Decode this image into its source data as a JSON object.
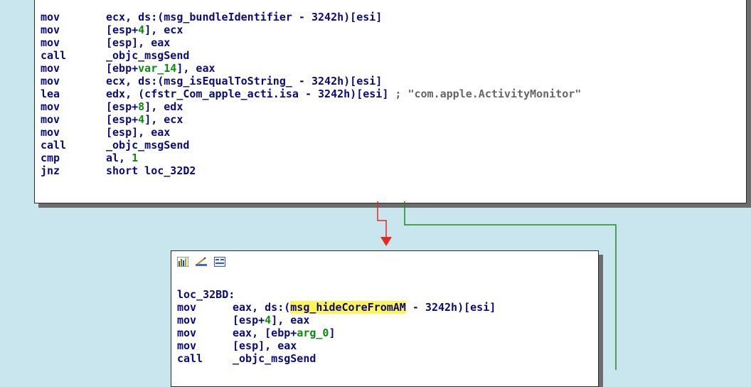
{
  "top_block": {
    "lines": [
      {
        "mnemonic": "mov",
        "p1": "ecx, ds:(msg_bundleIdentifier - 3242h)[esi]"
      },
      {
        "mnemonic": "mov",
        "p1": "[esp+",
        "n1": "4",
        "p2": "], ecx"
      },
      {
        "mnemonic": "mov",
        "p1": "[esp], eax"
      },
      {
        "mnemonic": "call",
        "p1": "_objc_msgSend"
      },
      {
        "mnemonic": "mov",
        "p1": "[ebp+",
        "v1": "var_14",
        "p2": "], eax"
      },
      {
        "mnemonic": "mov",
        "p1": "ecx, ds:(msg_isEqualToString_ - 3242h)[esi]"
      },
      {
        "mnemonic": "lea",
        "p1": "edx, (cfstr_Com_apple_acti.isa - 3242h)[esi]",
        "comment": " ; \"com.apple.ActivityMonitor\""
      },
      {
        "mnemonic": "mov",
        "p1": "[esp+",
        "n1": "8",
        "p2": "], edx"
      },
      {
        "mnemonic": "mov",
        "p1": "[esp+",
        "n1": "4",
        "p2": "], ecx"
      },
      {
        "mnemonic": "mov",
        "p1": "[esp], eax"
      },
      {
        "mnemonic": "call",
        "p1": "_objc_msgSend"
      },
      {
        "mnemonic": "cmp",
        "p1": "al, ",
        "n1": "1"
      },
      {
        "mnemonic": "jnz",
        "p1": "short loc_32D2"
      }
    ]
  },
  "bottom_block": {
    "label": "loc_32BD:",
    "lines": [
      {
        "mnemonic": "mov",
        "p1": "eax, ds:(",
        "h1": "msg_hideCoreFromAM",
        "p2": " - 3242h)[esi]"
      },
      {
        "mnemonic": "mov",
        "p1": "[esp+",
        "n1": "4",
        "p2": "], eax"
      },
      {
        "mnemonic": "mov",
        "p1": "eax, [ebp+",
        "v1": "arg_0",
        "p2": "]"
      },
      {
        "mnemonic": "mov",
        "p1": "[esp], eax"
      },
      {
        "mnemonic": "call",
        "p1": "_objc_msgSend"
      }
    ]
  },
  "toolbar_icons": [
    "graph-color-icon",
    "edit-pencil-icon",
    "hex-view-icon"
  ],
  "colors": {
    "background": "#c9e6ef",
    "mnemonic_text": "#0a0a7a",
    "number": "#0c8a0c",
    "highlight": "#fff45a",
    "edge_false": "#e8281e",
    "edge_true": "#1e8c1e"
  }
}
